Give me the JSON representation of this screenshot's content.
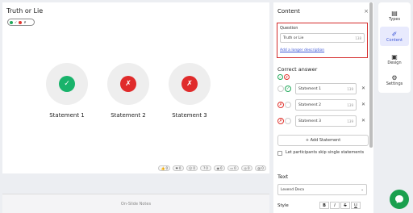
{
  "slide": {
    "title": "Truth or Lie",
    "statements": [
      {
        "label": "Statement 1",
        "mark": "✓",
        "state": "correct"
      },
      {
        "label": "Statement 2",
        "mark": "✗",
        "state": "wrong"
      },
      {
        "label": "Statement 3",
        "mark": "✗",
        "state": "wrong"
      }
    ],
    "reactions": [
      "0",
      "0",
      "0",
      "0",
      "0",
      "0",
      "0",
      "0"
    ]
  },
  "notes": {
    "label": "On-Slide Notes"
  },
  "panel": {
    "header": "Content",
    "question": {
      "label": "Question",
      "value": "Truth or Lie",
      "count": "138",
      "link": "Add a longer description"
    },
    "correct_answer_title": "Correct answer",
    "answers": [
      {
        "value": "Statement 1",
        "count": "139"
      },
      {
        "value": "Statement 2",
        "count": "139"
      },
      {
        "value": "Statement 3",
        "count": "139"
      }
    ],
    "add_statement": "+ Add Statement",
    "skip_label": "Let participants skip single statements",
    "text_title": "Text",
    "font_value": "Lexend Deca",
    "style_label": "Style",
    "style_buttons": [
      "B",
      "I",
      "S",
      "U"
    ]
  },
  "side": {
    "items": [
      {
        "label": "Types",
        "icon": "types-icon"
      },
      {
        "label": "Content",
        "icon": "content-icon"
      },
      {
        "label": "Design",
        "icon": "design-icon"
      },
      {
        "label": "Settings",
        "icon": "settings-icon"
      }
    ]
  },
  "colors": {
    "accent": "#3b55d6",
    "correct": "#19b36b",
    "wrong": "#e02b2b",
    "highlight": "#d42a2a",
    "chat": "#1aa04e"
  }
}
